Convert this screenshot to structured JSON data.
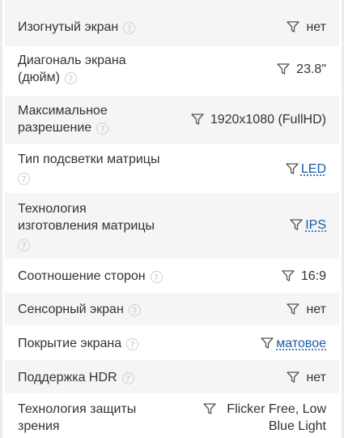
{
  "specs": [
    {
      "label": "Изогнутый экран",
      "value": "нет",
      "link": false,
      "help_icon": "help-icon"
    },
    {
      "label": "Диагональ экрана (дюйм)",
      "label_lines": [
        "Диагональ экрана",
        "(дюйм)"
      ],
      "value": "23.8\"",
      "link": false,
      "help_icon": "help-icon"
    },
    {
      "label": "Максимальное разрешение",
      "label_lines": [
        "Максимальное",
        "разрешение"
      ],
      "value": "1920x1080 (FullHD)",
      "link": false,
      "help_icon": "help-icon"
    },
    {
      "label": "Тип подсветки матрицы",
      "value": "LED",
      "link": true,
      "help_icon": "help-icon"
    },
    {
      "label": "Технология изготовления матрицы",
      "label_lines": [
        "Технология",
        "изготовления матрицы"
      ],
      "value": "IPS",
      "link": true,
      "help_icon": "help-icon"
    },
    {
      "label": "Соотношение сторон",
      "value": "16:9",
      "link": false,
      "help_icon": "help-icon"
    },
    {
      "label": "Сенсорный экран",
      "value": "нет",
      "link": false,
      "help_icon": "help-icon"
    },
    {
      "label": "Покрытие экрана",
      "value": "матовое",
      "link": true,
      "help_icon": "help-icon"
    },
    {
      "label": "Поддержка HDR",
      "value": "нет",
      "link": false,
      "help_icon": "help-icon"
    },
    {
      "label": "Технология защиты зрения",
      "label_lines": [
        "Технология защиты",
        "зрения"
      ],
      "value_lines": [
        "Flicker Free, Low",
        "Blue Light"
      ],
      "value": "Flicker Free, Low Blue Light",
      "link": false,
      "help_icon": "help-icon"
    }
  ],
  "help_glyph": "?",
  "colors": {
    "shaded_row": "#f5f5f5",
    "link": "#1b5aa6",
    "text": "#333333",
    "icon": "#c4c4c4"
  }
}
